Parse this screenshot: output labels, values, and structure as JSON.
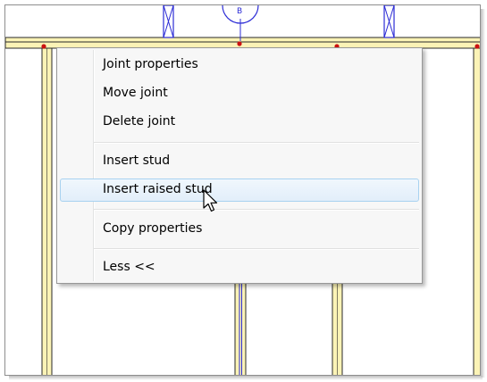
{
  "context_menu": {
    "items": [
      {
        "label": "Joint properties"
      },
      {
        "label": "Move joint"
      },
      {
        "label": "Delete joint"
      },
      {
        "label": "Insert stud"
      },
      {
        "label": "Insert raised stud"
      },
      {
        "label": "Copy properties"
      },
      {
        "label": "Less <<"
      }
    ],
    "highlighted_item": "Insert raised stud"
  },
  "colors": {
    "member_fill": "#fbf3b6",
    "member_stroke": "#2a2a2a",
    "joint_marker": "#cc1111",
    "brace_stroke": "#2b2bd6",
    "menu_highlight_border": "#a8d2f0"
  },
  "icons": {
    "pointer": "arrow-cursor-icon",
    "joint": "joint-marker-icon"
  }
}
